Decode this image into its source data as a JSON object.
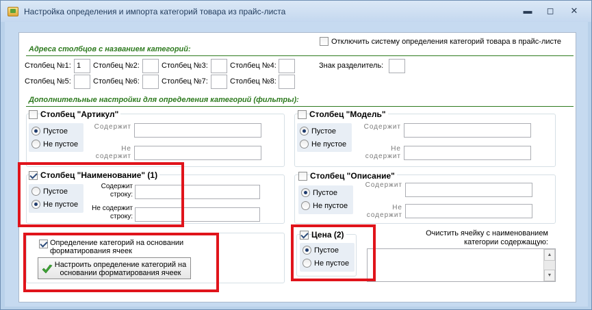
{
  "window": {
    "title": "Настройка определения и импорта категорий товара из прайс-листа",
    "minimize": "▬",
    "maximize": "◻",
    "close": "✕"
  },
  "top": {
    "disable_label": "Отключить систему определения категорий товара в прайс-листе",
    "disable_checked": false
  },
  "columns_section": {
    "title": "Адреса столбцов с названием категорий:",
    "fields": [
      {
        "label": "Столбец №1:",
        "value": "1"
      },
      {
        "label": "Столбец №2:",
        "value": ""
      },
      {
        "label": "Столбец №3:",
        "value": ""
      },
      {
        "label": "Столбец №4:",
        "value": ""
      },
      {
        "label": "Столбец №5:",
        "value": ""
      },
      {
        "label": "Столбец №6:",
        "value": ""
      },
      {
        "label": "Столбец №7:",
        "value": ""
      },
      {
        "label": "Столбец №8:",
        "value": ""
      }
    ],
    "separator_label": "Знак разделитель:",
    "separator_value": ""
  },
  "filters_section": {
    "title": "Дополнительные настройки для определения категорий (фильтры):",
    "article": {
      "label": "Столбец \"Артикул\"",
      "checked": false,
      "empty": "Пустое",
      "not_empty": "Не пустое",
      "selected": "empty",
      "contains": "Содержит",
      "not_contains": "Не содержит"
    },
    "model": {
      "label": "Столбец \"Модель\"",
      "checked": false,
      "empty": "Пустое",
      "not_empty": "Не пустое",
      "selected": "empty",
      "contains": "Содержит",
      "not_contains": "Не содержит"
    },
    "name": {
      "label": "Столбец \"Наименование\" (1)",
      "checked": true,
      "empty": "Пустое",
      "not_empty": "Не пустое",
      "selected": "not_empty",
      "contains_line1": "Содержит",
      "contains_line2": "строку:",
      "not_contains_line1": "Не содержит",
      "not_contains_line2": "строку:"
    },
    "description": {
      "label": "Столбец \"Описание\"",
      "checked": false,
      "empty": "Пустое",
      "not_empty": "Не пустое",
      "selected": "empty",
      "contains": "Содержит",
      "not_contains": "Не содержит"
    },
    "price": {
      "label": "Цена (2)",
      "checked": true,
      "empty": "Пустое",
      "not_empty": "Не пустое",
      "selected": "empty"
    }
  },
  "formatting": {
    "label_line1": "Определение категорий на основании",
    "label_line2": "форматирования ячеек",
    "checked": true,
    "button_line1": "Настроить определение категорий на",
    "button_line2": "основании форматирования ячеек"
  },
  "clear_cell": {
    "label_line1": "Очистить ячейку с наименованием",
    "label_line2": "категории содержащую:"
  },
  "colors": {
    "highlight": "#e0141b",
    "section_green": "#2d7a1e"
  }
}
